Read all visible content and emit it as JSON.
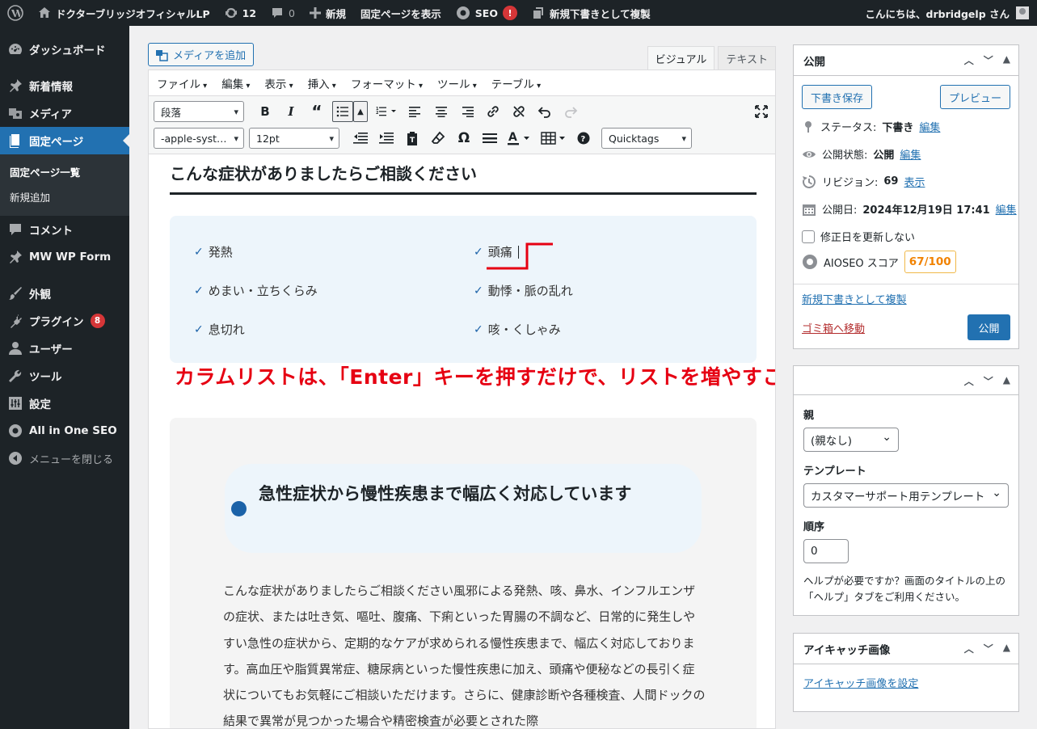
{
  "adminbar": {
    "site_name": "ドクターブリッジオフィシャルLP",
    "updates_count": "12",
    "comments_count": "0",
    "new_label": "新規",
    "view_page_label": "固定ページを表示",
    "seo_label": "SEO",
    "seo_alert": "!",
    "duplicate_label": "新規下書きとして複製",
    "greeting": "こんにちは、drbridgelp さん"
  },
  "sidebar": {
    "dashboard": "ダッシュボード",
    "posts": "新着情報",
    "media": "メディア",
    "pages": "固定ページ",
    "pages_sub": [
      "固定ページ一覧",
      "新規追加"
    ],
    "comments": "コメント",
    "mwform": "MW WP Form",
    "appearance": "外観",
    "plugins": "プラグイン",
    "plugins_badge": "8",
    "users": "ユーザー",
    "tools": "ツール",
    "settings": "設定",
    "aioseo": "All in One SEO",
    "collapse": "メニューを閉じる"
  },
  "editor": {
    "add_media": "メディアを追加",
    "tab_visual": "ビジュアル",
    "tab_text": "テキスト",
    "menus": [
      "ファイル",
      "編集",
      "表示",
      "挿入",
      "フォーマット",
      "ツール",
      "テーブル"
    ],
    "format_select": "段落",
    "font_select": "-apple-syst…",
    "size_select": "12pt",
    "quicktags_select": "Quicktags"
  },
  "content": {
    "heading": "こんな症状がありましたらご相談ください",
    "list_left": [
      "発熱",
      "めまい・立ちくらみ",
      "息切れ"
    ],
    "list_right": [
      "頭痛",
      "動悸・脈の乱れ",
      "咳・くしゃみ"
    ],
    "annotation": "カラムリストは、「Enter」キーを押すだけで、リストを増やすことが可能",
    "card_title": "急性症状から慢性疾患まで幅広く対応しています",
    "card_paragraph": "こんな症状がありましたらご相談ください風邪による発熱、咳、鼻水、インフルエンザの症状、または吐き気、嘔吐、腹痛、下痢といった胃腸の不調など、日常的に発生しやすい急性の症状から、定期的なケアが求められる慢性疾患まで、幅広く対応しております。高血圧や脂質異常症、糖尿病といった慢性疾患に加え、頭痛や便秘などの長引く症状についてもお気軽にご相談いただけます。さらに、健康診断や各種検査、人間ドックの結果で異常が見つかった場合や精密検査が必要とされた際"
  },
  "publish_box": {
    "title": "公開",
    "save_draft": "下書き保存",
    "preview": "プレビュー",
    "status_label": "ステータス:",
    "status_value": "下書き",
    "visibility_label": "公開状態:",
    "visibility_value": "公開",
    "revisions_label": "リビジョン:",
    "revisions_value": "69",
    "revisions_link": "表示",
    "date_label": "公開日:",
    "date_value": "2024年12月19日 17:41",
    "edit_link": "編集",
    "no_update_date": "修正日を更新しない",
    "aioseo_label": "AIOSEO スコア",
    "aioseo_score": "67/100",
    "duplicate_link": "新規下書きとして複製",
    "trash_link": "ゴミ箱へ移動",
    "publish_button": "公開"
  },
  "attributes_box": {
    "parent_label": "親",
    "parent_value": "(親なし)",
    "template_label": "テンプレート",
    "template_value": "カスタマーサポート用テンプレート",
    "order_label": "順序",
    "order_value": "0",
    "help_text": "ヘルプが必要ですか？画面のタイトルの上の「ヘルプ」タブをご利用ください。"
  },
  "featured_box": {
    "title": "アイキャッチ画像",
    "set_link": "アイキャッチ画像を設定"
  }
}
